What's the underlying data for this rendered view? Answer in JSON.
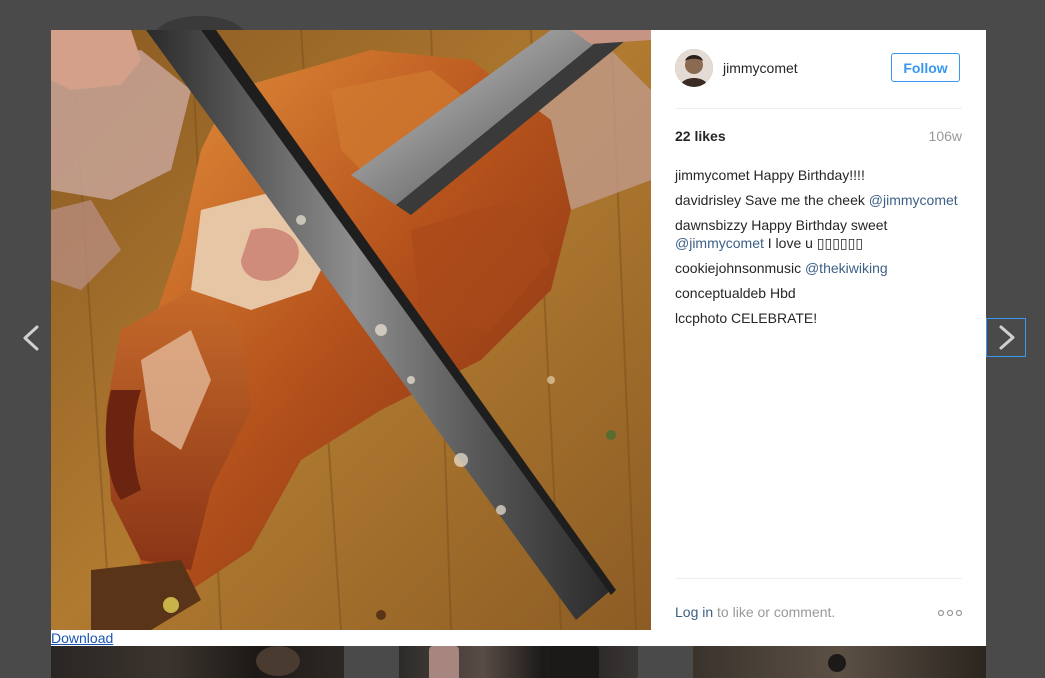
{
  "post": {
    "username": "jimmycomet",
    "follow_label": "Follow",
    "likes": "22 likes",
    "age": "106w",
    "download_label": "Download"
  },
  "comments": [
    {
      "author": "jimmycomet",
      "text": " Happy Birthday!!!!",
      "mention": "",
      "text_after": ""
    },
    {
      "author": "davidrisley",
      "text": " Save me the cheek ",
      "mention": "@jimmycomet",
      "text_after": ""
    },
    {
      "author": "dawnsbizzy",
      "text": " Happy Birthday sweet ",
      "mention": "@jimmycomet",
      "text_after": " I love u ▯▯▯▯▯▯"
    },
    {
      "author": "cookiejohnsonmusic",
      "text": " ",
      "mention": "@thekiwiking",
      "text_after": ""
    },
    {
      "author": "conceptualdeb",
      "text": " Hbd",
      "mention": "",
      "text_after": ""
    },
    {
      "author": "lccphoto",
      "text": " CELEBRATE!",
      "mention": "",
      "text_after": ""
    }
  ],
  "footer": {
    "login_link": "Log in",
    "login_rest": " to like or comment.",
    "more_icon": "ellipsis-icon"
  },
  "navigation": {
    "prev_icon": "chevron-left-icon",
    "next_icon": "chevron-right-icon"
  },
  "colors": {
    "accent": "#3897f0",
    "link": "#3d5f85",
    "overlay": "#4a4a4a",
    "muted": "#999999"
  }
}
